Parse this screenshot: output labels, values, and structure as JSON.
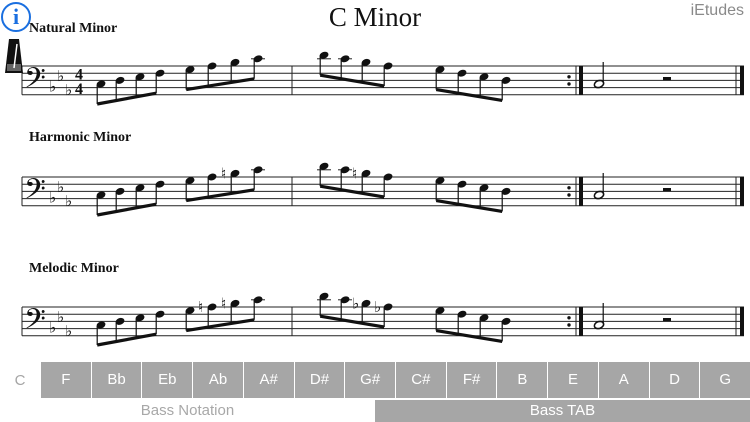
{
  "app": {
    "brand": "iEtudes",
    "info_glyph": "i",
    "metronome_icon": "metronome-icon",
    "info_icon": "info-icon"
  },
  "title": "C Minor",
  "sections": [
    {
      "label": "Natural Minor",
      "time_signature": [
        "4",
        "4"
      ],
      "measure1": [
        "C3",
        "D3",
        "E3",
        "F3",
        "G3",
        "A3",
        "B3",
        "C4"
      ],
      "measure1_acc": [
        "",
        "",
        "",
        "",
        "",
        "",
        "",
        ""
      ],
      "measure2": [
        "D4",
        "C4",
        "B3",
        "A3",
        "G3",
        "F3",
        "E3",
        "D3"
      ],
      "measure2_acc": [
        "",
        "",
        "",
        "",
        "",
        "",
        "",
        ""
      ],
      "final": {
        "note": "C3",
        "duration": "half",
        "rest": "half"
      }
    },
    {
      "label": "Harmonic Minor",
      "time_signature": null,
      "measure1": [
        "C3",
        "D3",
        "E3",
        "F3",
        "G3",
        "A3",
        "B3",
        "C4"
      ],
      "measure1_acc": [
        "",
        "",
        "",
        "",
        "",
        "",
        "natural",
        ""
      ],
      "measure2": [
        "D4",
        "C4",
        "B3",
        "A3",
        "G3",
        "F3",
        "E3",
        "D3"
      ],
      "measure2_acc": [
        "",
        "",
        "natural",
        "",
        "",
        "",
        "",
        ""
      ],
      "final": {
        "note": "C3",
        "duration": "half",
        "rest": "half"
      }
    },
    {
      "label": "Melodic Minor",
      "time_signature": null,
      "measure1": [
        "C3",
        "D3",
        "E3",
        "F3",
        "G3",
        "A3",
        "B3",
        "C4"
      ],
      "measure1_acc": [
        "",
        "",
        "",
        "",
        "",
        "natural",
        "natural",
        ""
      ],
      "measure2": [
        "D4",
        "C4",
        "B3",
        "A3",
        "G3",
        "F3",
        "E3",
        "D3"
      ],
      "measure2_acc": [
        "",
        "",
        "flat",
        "flat",
        "",
        "",
        "",
        ""
      ],
      "final": {
        "note": "C3",
        "duration": "half",
        "rest": "half"
      }
    }
  ],
  "key_selector": {
    "current": "C",
    "keys": [
      "F",
      "Bb",
      "Eb",
      "Ab",
      "A#",
      "D#",
      "G#",
      "C#",
      "F#",
      "B",
      "E",
      "A",
      "D",
      "G"
    ]
  },
  "modes": [
    {
      "label": "Bass Notation",
      "active": false
    },
    {
      "label": "Bass TAB",
      "active": true
    }
  ],
  "colors": {
    "accent": "#1a6fe0",
    "key_button": "#a6a6a6",
    "brand": "#8a8a8a"
  }
}
